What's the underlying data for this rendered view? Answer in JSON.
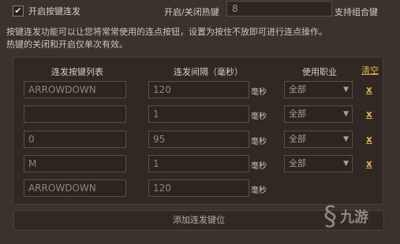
{
  "header": {
    "enable_label": "开启按键连发",
    "enabled": true,
    "hotkey_label": "开启/关闭热键",
    "hotkey_value": "8",
    "hotkey_hint": "支持组合键"
  },
  "description": [
    "按键连发功能可以让您将常常使用的连点按钮，设置为按住不放即可进行连点操作。",
    "热键的关闭和开启仅单次有效。"
  ],
  "table": {
    "col_key": "连发按键列表",
    "col_interval": "连发间隔（毫秒）",
    "col_job": "使用职业",
    "clear_label": "清空",
    "unit": "毫秒",
    "rows": [
      {
        "key": "ARROWDOWN",
        "interval": "120",
        "job": "全部",
        "delete": "x"
      },
      {
        "key": "",
        "interval": "1",
        "job": "全部",
        "delete": "x"
      },
      {
        "key": "0",
        "interval": "95",
        "job": "全部",
        "delete": "x"
      },
      {
        "key": "M",
        "interval": "1",
        "job": "全部",
        "delete": "x"
      },
      {
        "key": "ARROWDOWN",
        "interval": "120",
        "job": "",
        "delete": ""
      }
    ]
  },
  "add_button": "添加连发键位",
  "watermark": "九游"
}
